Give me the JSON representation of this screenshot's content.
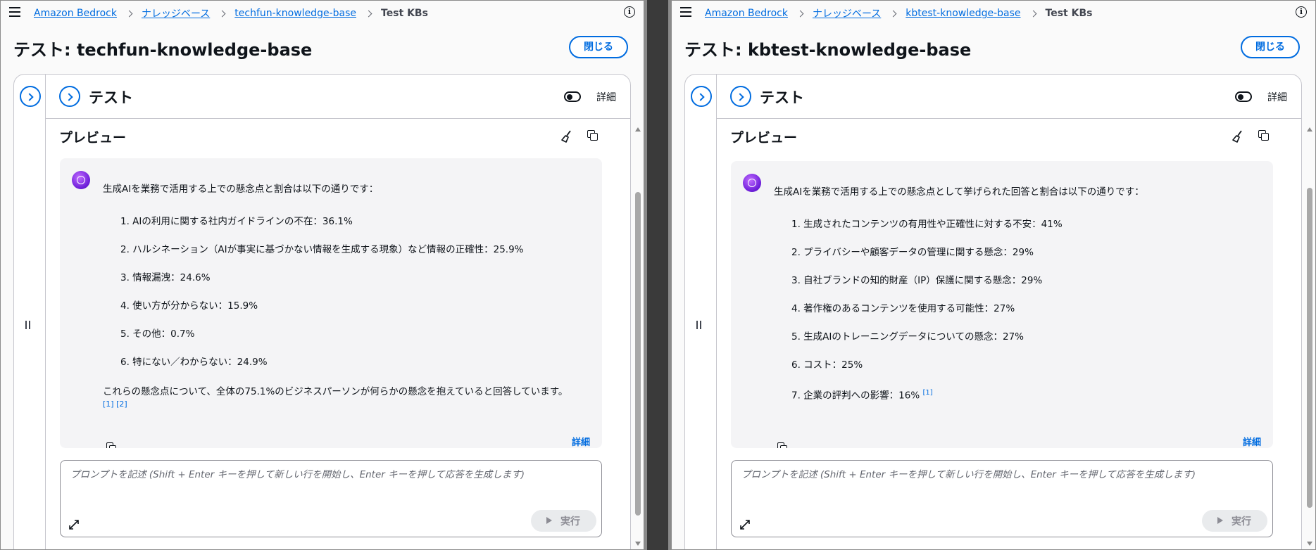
{
  "left": {
    "breadcrumb": [
      "Amazon Bedrock",
      "ナレッジベース",
      "techfun-knowledge-base"
    ],
    "breadcrumb_current": "Test KBs",
    "title": "テスト: techfun-knowledge-base",
    "close_label": "閉じる",
    "test_title": "テスト",
    "detail_toggle_label": "詳細",
    "preview_title": "プレビュー",
    "answer_intro": "生成AIを業務で活用する上での懸念点と割合は以下の通りです：",
    "answer_items": [
      "1. AIの利用に関する社内ガイドラインの不在：36.1%",
      "2. ハルシネーション（AIが事実に基づかない情報を生成する現象）など情報の正確性：25.9%",
      "3. 情報漏洩：24.6%",
      "4. 使い方が分からない：15.9%",
      "5. その他：0.7%",
      "6. 特にない／わからない：24.9%"
    ],
    "answer_outro": "これらの懸念点について、全体の75.1%のビジネスパーソンが何らかの懸念を抱えていると回答しています。",
    "citations": "[1] [2]",
    "card_detail_link": "詳細",
    "prompt_placeholder": "プロンプトを記述 (Shift + Enter キーを押して新しい行を開始し、Enter キーを押して応答を生成します)",
    "run_label": "実行"
  },
  "right": {
    "breadcrumb": [
      "Amazon Bedrock",
      "ナレッジベース",
      "kbtest-knowledge-base"
    ],
    "breadcrumb_current": "Test KBs",
    "title": "テスト: kbtest-knowledge-base",
    "close_label": "閉じる",
    "test_title": "テスト",
    "detail_toggle_label": "詳細",
    "preview_title": "プレビュー",
    "answer_intro": "生成AIを業務で活用する上での懸念点として挙げられた回答と割合は以下の通りです：",
    "answer_items": [
      "1. 生成されたコンテンツの有用性や正確性に対する不安：41%",
      "2. プライバシーや顧客データの管理に関する懸念：29%",
      "3. 自社ブランドの知的財産（IP）保護に関する懸念：29%",
      "4. 著作権のあるコンテンツを使用する可能性：27%",
      "5. 生成AIのトレーニングデータについての懸念：27%",
      "6. コスト：25%",
      "7. 企業の評判への影響：16%"
    ],
    "last_item_citation": "[1]",
    "card_detail_link": "詳細",
    "prompt_placeholder": "プロンプトを記述 (Shift + Enter キーを押して新しい行を開始し、Enter キーを押して応答を生成します)",
    "run_label": "実行"
  },
  "colors": {
    "accent": "#006ce0",
    "text": "#0f141a",
    "card_bg": "#f4f4f6"
  },
  "icons": [
    "menu-icon",
    "chevron-right-icon",
    "info-icon",
    "broom-icon",
    "copy-icon",
    "expand-icon",
    "play-icon",
    "avatar-icon"
  ]
}
